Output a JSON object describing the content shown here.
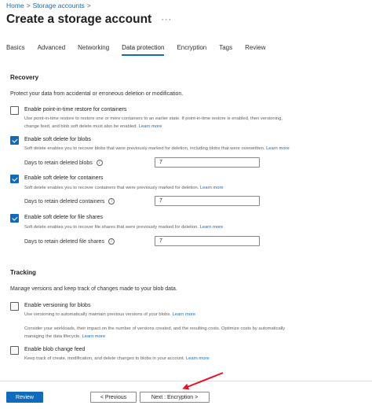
{
  "breadcrumb": [
    {
      "label": "Home"
    },
    {
      "label": "Storage accounts"
    }
  ],
  "breadcrumb_sep": ">",
  "page_title": "Create a storage account",
  "more_label": "···",
  "tabs": [
    {
      "label": "Basics"
    },
    {
      "label": "Advanced"
    },
    {
      "label": "Networking"
    },
    {
      "label": "Data protection",
      "active": true
    },
    {
      "label": "Encryption"
    },
    {
      "label": "Tags"
    },
    {
      "label": "Review"
    }
  ],
  "recovery": {
    "title": "Recovery",
    "intro": "Protect your data from accidental or erroneous deletion or modification.",
    "pitr": {
      "label": "Enable point-in-time restore for containers",
      "checked": false,
      "desc1": "Use point-in-time restore to restore one or more containers to an earlier state. If point-in-time restore is enabled, then versioning,",
      "desc2": "change feed, and blob soft delete must also be enabled.",
      "link": "Learn more"
    },
    "blobs": {
      "label": "Enable soft delete for blobs",
      "checked": true,
      "desc": "Soft delete enables you to recover blobs that were previously marked for deletion, including blobs that were overwritten.",
      "link": "Learn more",
      "retain_label": "Days to retain deleted blobs",
      "retain_value": "7"
    },
    "containers": {
      "label": "Enable soft delete for containers",
      "checked": true,
      "desc": "Soft delete enables you to recover containers that were previously marked for deletion.",
      "link": "Learn more",
      "retain_label": "Days to retain deleted containers",
      "retain_value": "7"
    },
    "shares": {
      "label": "Enable soft delete for file shares",
      "checked": true,
      "desc": "Soft delete enables you to recover file shares that were previously marked for deletion.",
      "link": "Learn more",
      "retain_label": "Days to retain deleted file shares",
      "retain_value": "7"
    }
  },
  "tracking": {
    "title": "Tracking",
    "intro": "Manage versions and keep track of changes made to your blob data.",
    "versioning": {
      "label": "Enable versioning for blobs",
      "checked": false,
      "desc": "Use versioning to automatically maintain previous versions of your blobs.",
      "link": "Learn more",
      "note1": "Consider your workloads, their impact on the number of versions created, and the resulting costs. Optimize costs by automatically",
      "note2": "managing the data lifecycle.",
      "note_link": "Learn more"
    },
    "changefeed": {
      "label": "Enable blob change feed",
      "checked": false,
      "desc": "Keep track of create, modification, and delete changes to blobs in your account.",
      "link": "Learn more"
    }
  },
  "footer": {
    "review": "Review",
    "previous": "< Previous",
    "next": "Next : Encryption >"
  },
  "colors": {
    "accent": "#0f6cbd",
    "annotation_arrow": "#e81123"
  }
}
